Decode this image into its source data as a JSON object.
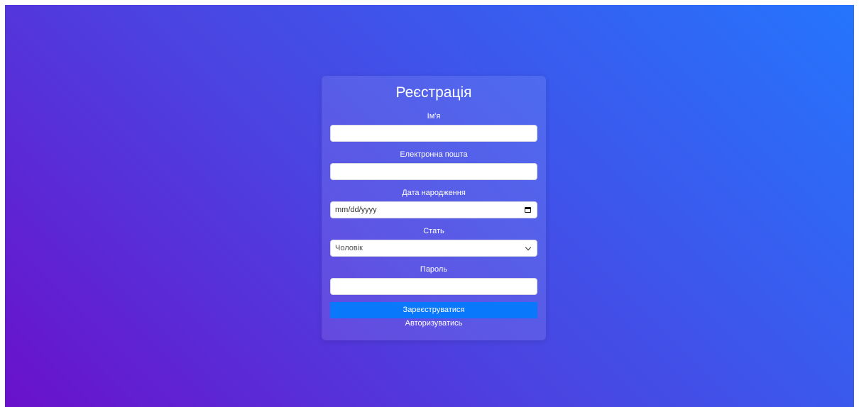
{
  "form": {
    "title": "Реєстрація",
    "fields": {
      "name": {
        "label": "Ім'я",
        "value": ""
      },
      "email": {
        "label": "Електронна пошта",
        "value": ""
      },
      "birthdate": {
        "label": "Дата народження",
        "placeholder": "mm/dd/yyyy"
      },
      "gender": {
        "label": "Стать",
        "selected": "Чоловік"
      },
      "password": {
        "label": "Пароль",
        "value": ""
      }
    },
    "submit_label": "Зареєструватися",
    "login_link": "Авторизуватись"
  },
  "colors": {
    "gradient_start": "#6a11cb",
    "gradient_end": "#2575fc",
    "button": "#0a78fa"
  },
  "icons": {
    "date": "calendar-icon",
    "select": "chevron-down-icon"
  }
}
